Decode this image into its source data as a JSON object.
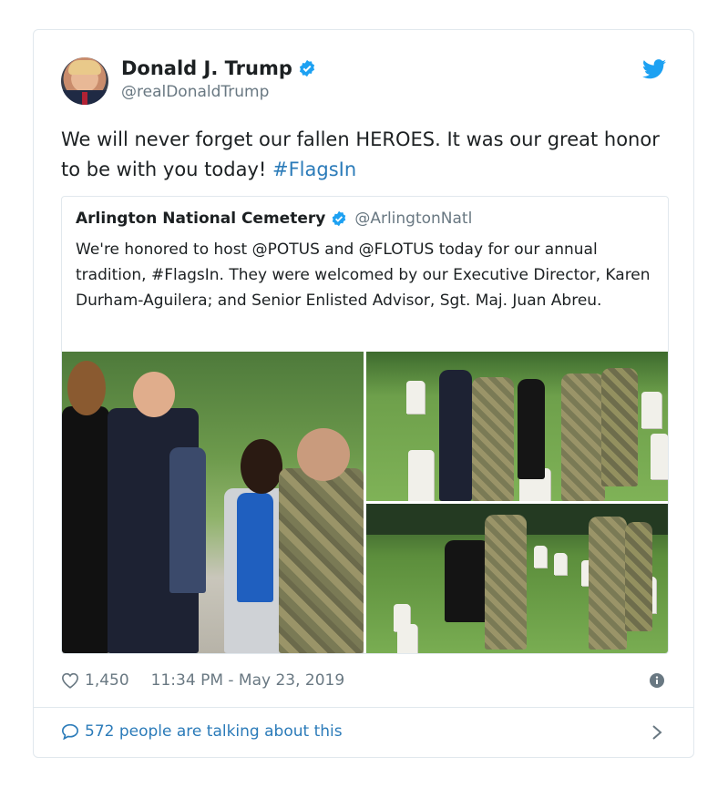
{
  "tweet": {
    "author_name": "Donald J. Trump",
    "author_handle": "@realDonaldTrump",
    "text_main": "We will never forget our fallen HEROES. It was our great honor to be with you today! ",
    "hashtag": "#FlagsIn",
    "likes": "1,450",
    "timestamp": "11:34 PM - May 23, 2019",
    "talking": "572 people are talking about this"
  },
  "quoted": {
    "author_name": "Arlington National Cemetery",
    "author_handle": "@ArlingtonNatl",
    "text": "We're honored to host @POTUS and @FLOTUS today for our annual tradition, #FlagsIn. They were welcomed by our Executive Director, Karen Durham-Aguilera; and Senior Enlisted Advisor, Sgt. Maj. Juan Abreu."
  },
  "icons": {
    "verified": "verified-badge-icon",
    "bird": "twitter-bird-icon",
    "heart": "heart-icon",
    "info": "info-icon",
    "bubble": "speech-bubble-icon",
    "chevron": "chevron-right-icon"
  },
  "colors": {
    "link": "#2b7bb9",
    "verified": "#1da1f2",
    "muted": "#697882",
    "border": "#e1e8ed"
  }
}
